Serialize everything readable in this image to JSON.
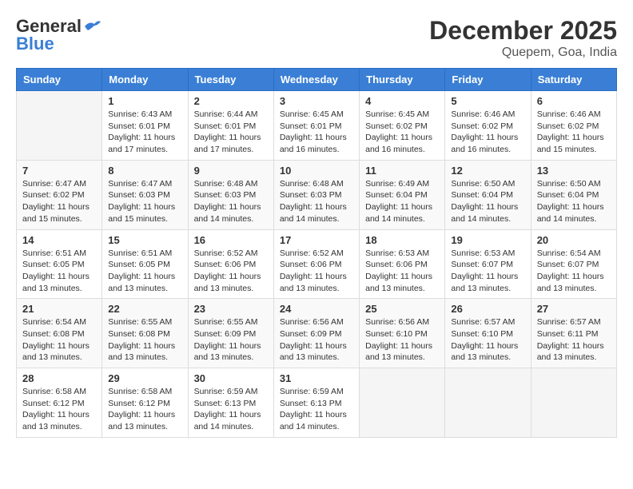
{
  "header": {
    "logo_general": "General",
    "logo_blue": "Blue",
    "month_title": "December 2025",
    "location": "Quepem, Goa, India"
  },
  "days_of_week": [
    "Sunday",
    "Monday",
    "Tuesday",
    "Wednesday",
    "Thursday",
    "Friday",
    "Saturday"
  ],
  "weeks": [
    [
      {
        "day": "",
        "sunrise": "",
        "sunset": "",
        "daylight": ""
      },
      {
        "day": "1",
        "sunrise": "Sunrise: 6:43 AM",
        "sunset": "Sunset: 6:01 PM",
        "daylight": "Daylight: 11 hours and 17 minutes."
      },
      {
        "day": "2",
        "sunrise": "Sunrise: 6:44 AM",
        "sunset": "Sunset: 6:01 PM",
        "daylight": "Daylight: 11 hours and 17 minutes."
      },
      {
        "day": "3",
        "sunrise": "Sunrise: 6:45 AM",
        "sunset": "Sunset: 6:01 PM",
        "daylight": "Daylight: 11 hours and 16 minutes."
      },
      {
        "day": "4",
        "sunrise": "Sunrise: 6:45 AM",
        "sunset": "Sunset: 6:02 PM",
        "daylight": "Daylight: 11 hours and 16 minutes."
      },
      {
        "day": "5",
        "sunrise": "Sunrise: 6:46 AM",
        "sunset": "Sunset: 6:02 PM",
        "daylight": "Daylight: 11 hours and 16 minutes."
      },
      {
        "day": "6",
        "sunrise": "Sunrise: 6:46 AM",
        "sunset": "Sunset: 6:02 PM",
        "daylight": "Daylight: 11 hours and 15 minutes."
      }
    ],
    [
      {
        "day": "7",
        "sunrise": "Sunrise: 6:47 AM",
        "sunset": "Sunset: 6:02 PM",
        "daylight": "Daylight: 11 hours and 15 minutes."
      },
      {
        "day": "8",
        "sunrise": "Sunrise: 6:47 AM",
        "sunset": "Sunset: 6:03 PM",
        "daylight": "Daylight: 11 hours and 15 minutes."
      },
      {
        "day": "9",
        "sunrise": "Sunrise: 6:48 AM",
        "sunset": "Sunset: 6:03 PM",
        "daylight": "Daylight: 11 hours and 14 minutes."
      },
      {
        "day": "10",
        "sunrise": "Sunrise: 6:48 AM",
        "sunset": "Sunset: 6:03 PM",
        "daylight": "Daylight: 11 hours and 14 minutes."
      },
      {
        "day": "11",
        "sunrise": "Sunrise: 6:49 AM",
        "sunset": "Sunset: 6:04 PM",
        "daylight": "Daylight: 11 hours and 14 minutes."
      },
      {
        "day": "12",
        "sunrise": "Sunrise: 6:50 AM",
        "sunset": "Sunset: 6:04 PM",
        "daylight": "Daylight: 11 hours and 14 minutes."
      },
      {
        "day": "13",
        "sunrise": "Sunrise: 6:50 AM",
        "sunset": "Sunset: 6:04 PM",
        "daylight": "Daylight: 11 hours and 14 minutes."
      }
    ],
    [
      {
        "day": "14",
        "sunrise": "Sunrise: 6:51 AM",
        "sunset": "Sunset: 6:05 PM",
        "daylight": "Daylight: 11 hours and 13 minutes."
      },
      {
        "day": "15",
        "sunrise": "Sunrise: 6:51 AM",
        "sunset": "Sunset: 6:05 PM",
        "daylight": "Daylight: 11 hours and 13 minutes."
      },
      {
        "day": "16",
        "sunrise": "Sunrise: 6:52 AM",
        "sunset": "Sunset: 6:06 PM",
        "daylight": "Daylight: 11 hours and 13 minutes."
      },
      {
        "day": "17",
        "sunrise": "Sunrise: 6:52 AM",
        "sunset": "Sunset: 6:06 PM",
        "daylight": "Daylight: 11 hours and 13 minutes."
      },
      {
        "day": "18",
        "sunrise": "Sunrise: 6:53 AM",
        "sunset": "Sunset: 6:06 PM",
        "daylight": "Daylight: 11 hours and 13 minutes."
      },
      {
        "day": "19",
        "sunrise": "Sunrise: 6:53 AM",
        "sunset": "Sunset: 6:07 PM",
        "daylight": "Daylight: 11 hours and 13 minutes."
      },
      {
        "day": "20",
        "sunrise": "Sunrise: 6:54 AM",
        "sunset": "Sunset: 6:07 PM",
        "daylight": "Daylight: 11 hours and 13 minutes."
      }
    ],
    [
      {
        "day": "21",
        "sunrise": "Sunrise: 6:54 AM",
        "sunset": "Sunset: 6:08 PM",
        "daylight": "Daylight: 11 hours and 13 minutes."
      },
      {
        "day": "22",
        "sunrise": "Sunrise: 6:55 AM",
        "sunset": "Sunset: 6:08 PM",
        "daylight": "Daylight: 11 hours and 13 minutes."
      },
      {
        "day": "23",
        "sunrise": "Sunrise: 6:55 AM",
        "sunset": "Sunset: 6:09 PM",
        "daylight": "Daylight: 11 hours and 13 minutes."
      },
      {
        "day": "24",
        "sunrise": "Sunrise: 6:56 AM",
        "sunset": "Sunset: 6:09 PM",
        "daylight": "Daylight: 11 hours and 13 minutes."
      },
      {
        "day": "25",
        "sunrise": "Sunrise: 6:56 AM",
        "sunset": "Sunset: 6:10 PM",
        "daylight": "Daylight: 11 hours and 13 minutes."
      },
      {
        "day": "26",
        "sunrise": "Sunrise: 6:57 AM",
        "sunset": "Sunset: 6:10 PM",
        "daylight": "Daylight: 11 hours and 13 minutes."
      },
      {
        "day": "27",
        "sunrise": "Sunrise: 6:57 AM",
        "sunset": "Sunset: 6:11 PM",
        "daylight": "Daylight: 11 hours and 13 minutes."
      }
    ],
    [
      {
        "day": "28",
        "sunrise": "Sunrise: 6:58 AM",
        "sunset": "Sunset: 6:12 PM",
        "daylight": "Daylight: 11 hours and 13 minutes."
      },
      {
        "day": "29",
        "sunrise": "Sunrise: 6:58 AM",
        "sunset": "Sunset: 6:12 PM",
        "daylight": "Daylight: 11 hours and 13 minutes."
      },
      {
        "day": "30",
        "sunrise": "Sunrise: 6:59 AM",
        "sunset": "Sunset: 6:13 PM",
        "daylight": "Daylight: 11 hours and 14 minutes."
      },
      {
        "day": "31",
        "sunrise": "Sunrise: 6:59 AM",
        "sunset": "Sunset: 6:13 PM",
        "daylight": "Daylight: 11 hours and 14 minutes."
      },
      {
        "day": "",
        "sunrise": "",
        "sunset": "",
        "daylight": ""
      },
      {
        "day": "",
        "sunrise": "",
        "sunset": "",
        "daylight": ""
      },
      {
        "day": "",
        "sunrise": "",
        "sunset": "",
        "daylight": ""
      }
    ]
  ]
}
